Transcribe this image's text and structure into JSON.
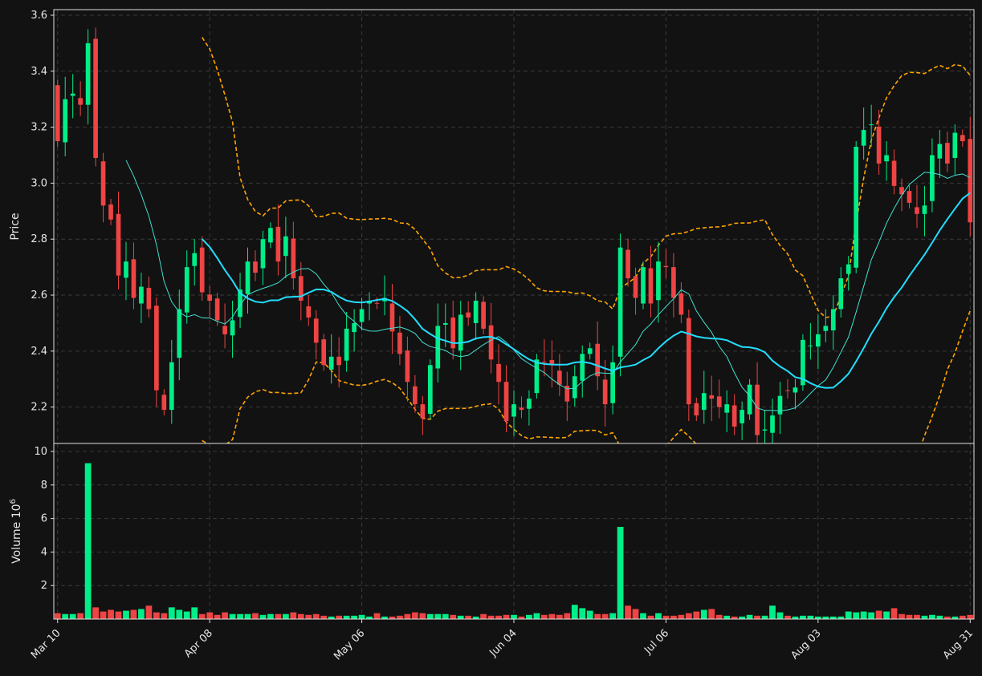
{
  "chart_data": {
    "type": "candlestick",
    "style": {
      "background": "#121212",
      "up_color": "#00ee88",
      "down_color": "#ee4444",
      "grid": true,
      "grid_style": "dashed"
    },
    "price_panel": {
      "ylabel": "Price",
      "ylim": [
        2.07,
        3.62
      ],
      "yticks": [
        "2.2",
        "2.4",
        "2.6",
        "2.8",
        "3.0",
        "3.2",
        "3.4",
        "3.6"
      ]
    },
    "volume_panel": {
      "ylabel": "Volume",
      "ylabel_exponent": "10^6",
      "ylim": [
        0,
        10
      ],
      "yticks": [
        "2",
        "4",
        "6",
        "8",
        "10"
      ]
    },
    "x_tick_labels": [
      "Mar 10",
      "Apr 08",
      "May 06",
      "Jun 04",
      "Jul 06",
      "Aug 03",
      "Aug 31"
    ],
    "x_tick_indices": [
      0,
      20,
      40,
      60,
      80,
      100,
      120
    ],
    "overlays": [
      {
        "kind": "moving_average",
        "period": 10,
        "color": "#40e0d0",
        "width": "thin"
      },
      {
        "kind": "moving_average",
        "period": 20,
        "color": "#22ddff",
        "width": "thick"
      },
      {
        "kind": "bollinger_upper",
        "color": "#ffa500",
        "dash": true
      },
      {
        "kind": "bollinger_lower",
        "color": "#ffa500",
        "dash": true
      }
    ],
    "close": [
      3.15,
      3.3,
      3.32,
      3.28,
      3.5,
      3.09,
      2.92,
      2.87,
      2.67,
      2.72,
      2.59,
      2.63,
      2.55,
      2.26,
      2.19,
      2.36,
      2.55,
      2.7,
      2.75,
      2.61,
      2.58,
      2.51,
      2.46,
      2.51,
      2.62,
      2.72,
      2.68,
      2.8,
      2.84,
      2.72,
      2.81,
      2.66,
      2.58,
      2.52,
      2.43,
      2.35,
      2.38,
      2.35,
      2.48,
      2.5,
      2.55,
      2.58,
      2.57,
      2.59,
      2.47,
      2.39,
      2.29,
      2.21,
      2.16,
      2.35,
      2.49,
      2.5,
      2.41,
      2.53,
      2.52,
      2.58,
      2.48,
      2.37,
      2.29,
      2.15,
      2.21,
      2.19,
      2.23,
      2.37,
      2.36,
      2.35,
      2.28,
      2.22,
      2.31,
      2.39,
      2.41,
      2.31,
      2.21,
      2.36,
      2.77,
      2.66,
      2.59,
      2.7,
      2.57,
      2.72,
      2.7,
      2.59,
      2.53,
      2.21,
      2.17,
      2.25,
      2.23,
      2.2,
      2.21,
      2.13,
      2.19,
      2.28,
      2.1,
      2.12,
      2.17,
      2.24,
      2.26,
      2.27,
      2.44,
      2.42,
      2.46,
      2.49,
      2.55,
      2.66,
      2.71,
      3.13,
      3.19,
      3.21,
      3.07,
      3.1,
      2.99,
      2.96,
      2.93,
      2.89,
      2.92,
      3.1,
      3.14,
      3.07,
      3.18,
      3.15,
      2.86
    ],
    "volume": [
      0.35,
      0.3,
      0.3,
      0.35,
      9.3,
      0.7,
      0.45,
      0.55,
      0.45,
      0.5,
      0.55,
      0.6,
      0.8,
      0.4,
      0.35,
      0.7,
      0.55,
      0.45,
      0.7,
      0.3,
      0.4,
      0.25,
      0.4,
      0.3,
      0.3,
      0.3,
      0.35,
      0.25,
      0.3,
      0.3,
      0.3,
      0.4,
      0.3,
      0.25,
      0.3,
      0.2,
      0.15,
      0.2,
      0.2,
      0.2,
      0.25,
      0.15,
      0.35,
      0.15,
      0.15,
      0.2,
      0.3,
      0.4,
      0.35,
      0.3,
      0.3,
      0.3,
      0.25,
      0.2,
      0.2,
      0.15,
      0.3,
      0.2,
      0.2,
      0.25,
      0.25,
      0.15,
      0.25,
      0.35,
      0.25,
      0.3,
      0.25,
      0.35,
      0.85,
      0.65,
      0.5,
      0.3,
      0.3,
      0.35,
      5.5,
      0.8,
      0.6,
      0.35,
      0.2,
      0.35,
      0.2,
      0.2,
      0.25,
      0.35,
      0.45,
      0.55,
      0.6,
      0.25,
      0.2,
      0.15,
      0.15,
      0.25,
      0.2,
      0.2,
      0.8,
      0.4,
      0.2,
      0.15,
      0.2,
      0.2,
      0.15,
      0.15,
      0.15,
      0.15,
      0.45,
      0.4,
      0.45,
      0.4,
      0.5,
      0.45,
      0.65,
      0.3,
      0.25,
      0.25,
      0.2,
      0.25,
      0.2,
      0.15,
      0.15,
      0.2,
      0.25
    ]
  }
}
